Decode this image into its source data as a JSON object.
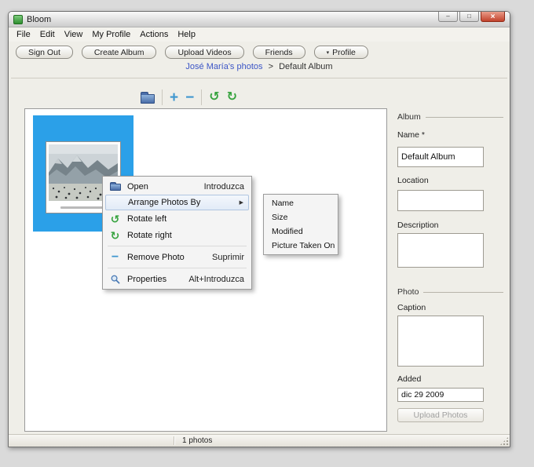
{
  "window": {
    "title": "Bloom",
    "controls": {
      "minimize": "–",
      "maximize": "□",
      "close": "×"
    }
  },
  "menubar": {
    "items": [
      "File",
      "Edit",
      "View",
      "My Profile",
      "Actions",
      "Help"
    ]
  },
  "toolbar": {
    "sign_out": "Sign Out",
    "create_album": "Create Album",
    "upload_videos": "Upload Videos",
    "friends": "Friends",
    "profile": "Profile"
  },
  "breadcrumb": {
    "link": "José María's photos",
    "separator": ">",
    "current": "Default Album"
  },
  "icons": {
    "plus": "+",
    "minus": "−",
    "rotate_left": "↺",
    "rotate_right": "↻",
    "submenu_arrow": "▶",
    "profile_arrow": "▾"
  },
  "context_menu": {
    "open": {
      "label": "Open",
      "shortcut": "Introduzca"
    },
    "arrange": {
      "label": "Arrange Photos By"
    },
    "rotate_left": {
      "label": "Rotate left"
    },
    "rotate_right": {
      "label": "Rotate right"
    },
    "remove": {
      "label": "Remove Photo",
      "shortcut": "Suprimir"
    },
    "properties": {
      "label": "Properties",
      "shortcut": "Alt+Introduzca"
    },
    "submenu": {
      "items": [
        "Name",
        "Size",
        "Modified",
        "Picture Taken On"
      ]
    }
  },
  "sidebar": {
    "album_section": "Album",
    "name_label": "Name *",
    "name_value": "Default Album",
    "location_label": "Location",
    "description_label": "Description",
    "photo_section": "Photo",
    "caption_label": "Caption",
    "added_label": "Added",
    "added_value": "dic 29 2009",
    "upload_button": "Upload Photos"
  },
  "statusbar": {
    "count": "1 photos"
  }
}
